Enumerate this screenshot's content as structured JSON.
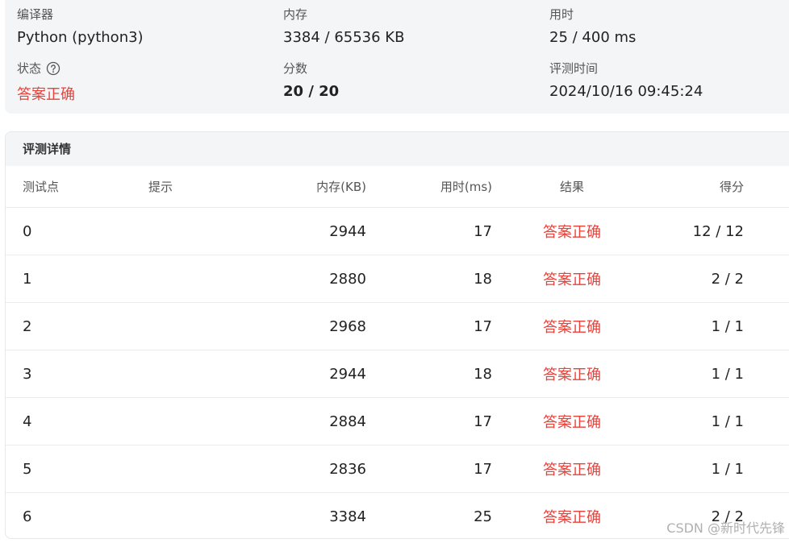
{
  "summary": {
    "compiler": {
      "label": "编译器",
      "value": "Python (python3)"
    },
    "memory": {
      "label": "内存",
      "value": "3384 / 65536 KB"
    },
    "time": {
      "label": "用时",
      "value": "25 / 400 ms"
    },
    "status": {
      "label": "状态",
      "value": "答案正确",
      "icon": "question-circle-icon",
      "color": "#e8413a"
    },
    "score": {
      "label": "分数",
      "value": "20 / 20"
    },
    "judge_time": {
      "label": "评测时间",
      "value": "2024/10/16 09:45:24"
    }
  },
  "details": {
    "title": "评测详情",
    "columns": [
      "测试点",
      "提示",
      "内存(KB)",
      "用时(ms)",
      "结果",
      "得分"
    ],
    "rows": [
      {
        "id": "0",
        "hint": "",
        "memory": "2944",
        "time": "17",
        "result": "答案正确",
        "score": "12 / 12"
      },
      {
        "id": "1",
        "hint": "",
        "memory": "2880",
        "time": "18",
        "result": "答案正确",
        "score": "2 / 2"
      },
      {
        "id": "2",
        "hint": "",
        "memory": "2968",
        "time": "17",
        "result": "答案正确",
        "score": "1 / 1"
      },
      {
        "id": "3",
        "hint": "",
        "memory": "2944",
        "time": "18",
        "result": "答案正确",
        "score": "1 / 1"
      },
      {
        "id": "4",
        "hint": "",
        "memory": "2884",
        "time": "17",
        "result": "答案正确",
        "score": "1 / 1"
      },
      {
        "id": "5",
        "hint": "",
        "memory": "2836",
        "time": "17",
        "result": "答案正确",
        "score": "1 / 1"
      },
      {
        "id": "6",
        "hint": "",
        "memory": "3384",
        "time": "25",
        "result": "答案正确",
        "score": "2 / 2"
      }
    ]
  },
  "watermark": "CSDN @新时代先锋"
}
